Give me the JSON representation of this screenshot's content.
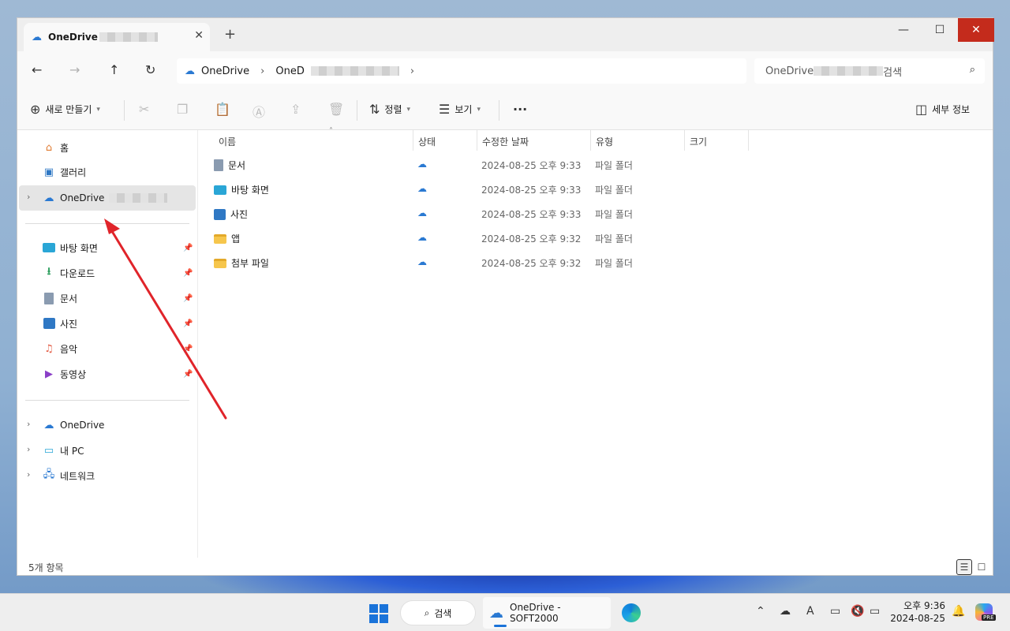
{
  "window": {
    "tab_title": "OneDrive",
    "new_tab": "+",
    "close_tab": "✕",
    "minimize": "—",
    "maximize": "☐",
    "close": "✕"
  },
  "nav": {
    "back": "←",
    "forward": "→",
    "up": "↑",
    "refresh": "↻",
    "breadcrumb": [
      "OneDrive",
      "OneD"
    ],
    "search_placeholder": "OneDrive",
    "search_suffix": "검색"
  },
  "toolbar": {
    "new_label": "새로 만들기",
    "sort_label": "정렬",
    "view_label": "보기",
    "more": "···",
    "details_label": "세부 정보"
  },
  "sidebar": {
    "top": [
      {
        "label": "홈",
        "icon": "home-icon"
      },
      {
        "label": "갤러리",
        "icon": "gallery-icon"
      },
      {
        "label": "OneDrive",
        "icon": "cloud-icon"
      }
    ],
    "pinned": [
      {
        "label": "바탕 화면",
        "icon": "desktop-icon"
      },
      {
        "label": "다운로드",
        "icon": "download-icon"
      },
      {
        "label": "문서",
        "icon": "document-icon"
      },
      {
        "label": "사진",
        "icon": "pictures-icon"
      },
      {
        "label": "음악",
        "icon": "music-icon"
      },
      {
        "label": "동영상",
        "icon": "videos-icon"
      }
    ],
    "bottom": [
      {
        "label": "OneDrive",
        "icon": "cloud-icon"
      },
      {
        "label": "내 PC",
        "icon": "pc-icon"
      },
      {
        "label": "네트워크",
        "icon": "network-icon"
      }
    ]
  },
  "columns": [
    "이름",
    "상태",
    "수정한 날짜",
    "유형",
    "크기"
  ],
  "files": [
    {
      "name": "문서",
      "icon": "document-folder-icon",
      "date": "2024-08-25 오후 9:33",
      "type": "파일 폴더"
    },
    {
      "name": "바탕 화면",
      "icon": "desktop-folder-icon",
      "date": "2024-08-25 오후 9:33",
      "type": "파일 폴더"
    },
    {
      "name": "사진",
      "icon": "pictures-folder-icon",
      "date": "2024-08-25 오후 9:33",
      "type": "파일 폴더"
    },
    {
      "name": "앱",
      "icon": "folder-icon",
      "date": "2024-08-25 오후 9:32",
      "type": "파일 폴더"
    },
    {
      "name": "첨부 파일",
      "icon": "folder-icon",
      "date": "2024-08-25 오후 9:32",
      "type": "파일 폴더"
    }
  ],
  "status": {
    "count": "5개 항목"
  },
  "taskbar": {
    "search_label": "검색",
    "app_label": "OneDrive - SOFT2000",
    "time": "오후 9:36",
    "date": "2024-08-25",
    "copilot_badge": "PRE"
  },
  "colors": {
    "accent": "#1a73d9",
    "close_red": "#c42b1c",
    "annotation_arrow": "#e0242a"
  }
}
